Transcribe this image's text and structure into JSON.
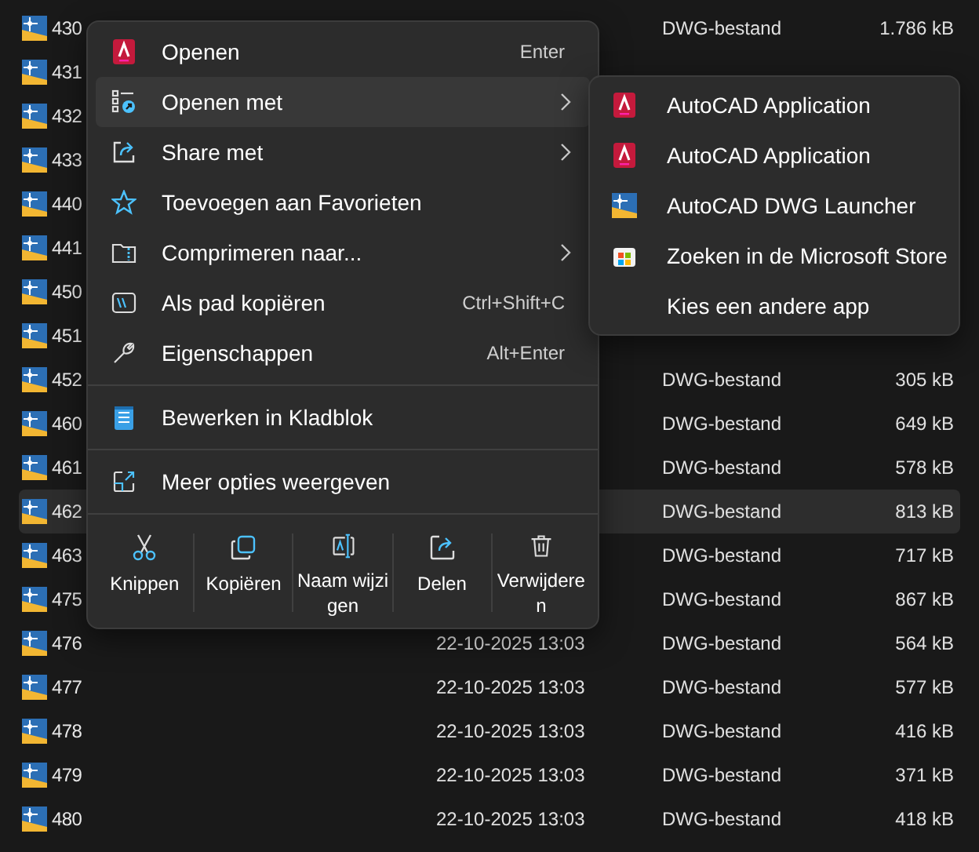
{
  "files": [
    {
      "name": "430",
      "type": "DWG-bestand",
      "size": "1.786 kB",
      "selected": false
    },
    {
      "name": "431",
      "selected": false
    },
    {
      "name": "432",
      "selected": false
    },
    {
      "name": "433",
      "selected": false
    },
    {
      "name": "440",
      "selected": false
    },
    {
      "name": "441",
      "selected": false
    },
    {
      "name": "450",
      "selected": false
    },
    {
      "name": "451",
      "selected": false
    },
    {
      "name": "452",
      "type": "DWG-bestand",
      "size": "305 kB",
      "selected": false
    },
    {
      "name": "460",
      "type": "DWG-bestand",
      "size": "649 kB",
      "selected": false
    },
    {
      "name": "461",
      "type": "DWG-bestand",
      "size": "578 kB",
      "selected": false
    },
    {
      "name": "462",
      "type": "DWG-bestand",
      "size": "813 kB",
      "selected": true
    },
    {
      "name": "463",
      "type": "DWG-bestand",
      "size": "717 kB",
      "selected": false
    },
    {
      "name": "475",
      "type": "DWG-bestand",
      "size": "867 kB",
      "selected": false
    },
    {
      "name": "476",
      "date": "22-10-2025 13:03",
      "type": "DWG-bestand",
      "size": "564 kB",
      "selected": false
    },
    {
      "name": "477",
      "date": "22-10-2025 13:03",
      "type": "DWG-bestand",
      "size": "577 kB",
      "selected": false
    },
    {
      "name": "478",
      "date": "22-10-2025 13:03",
      "type": "DWG-bestand",
      "size": "416 kB",
      "selected": false
    },
    {
      "name": "479",
      "date": "22-10-2025 13:03",
      "type": "DWG-bestand",
      "size": "371 kB",
      "selected": false
    },
    {
      "name": "480",
      "date": "22-10-2025 13:03",
      "type": "DWG-bestand",
      "size": "418 kB",
      "selected": false
    }
  ],
  "context_menu": {
    "groups": [
      [
        {
          "label": "Openen",
          "shortcut": "Enter",
          "submenu": false,
          "highlighted": false
        },
        {
          "label": "Openen met",
          "submenu": true,
          "highlighted": true
        },
        {
          "label": "Share met",
          "submenu": true,
          "highlighted": false
        },
        {
          "label": "Toevoegen aan Favorieten",
          "submenu": false,
          "highlighted": false
        },
        {
          "label": "Comprimeren naar...",
          "submenu": true,
          "highlighted": false
        },
        {
          "label": "Als pad kopiëren",
          "shortcut": "Ctrl+Shift+C",
          "submenu": false,
          "highlighted": false
        },
        {
          "label": "Eigenschappen",
          "shortcut": "Alt+Enter",
          "submenu": false,
          "highlighted": false
        }
      ],
      [
        {
          "label": "Bewerken in Kladblok",
          "submenu": false,
          "highlighted": false
        }
      ],
      [
        {
          "label": "Meer opties weergeven",
          "submenu": false,
          "highlighted": false
        }
      ]
    ],
    "actions": [
      {
        "label": "Knippen"
      },
      {
        "label": "Kopiëren"
      },
      {
        "label": "Naam wijzigen"
      },
      {
        "label": "Delen"
      },
      {
        "label": "Verwijderen"
      }
    ]
  },
  "submenu": {
    "items": [
      {
        "label": "AutoCAD Application"
      },
      {
        "label": "AutoCAD Application"
      },
      {
        "label": "AutoCAD DWG Launcher"
      },
      {
        "label": "Zoeken in de Microsoft Store"
      },
      {
        "label": "Kies een andere app"
      }
    ]
  }
}
